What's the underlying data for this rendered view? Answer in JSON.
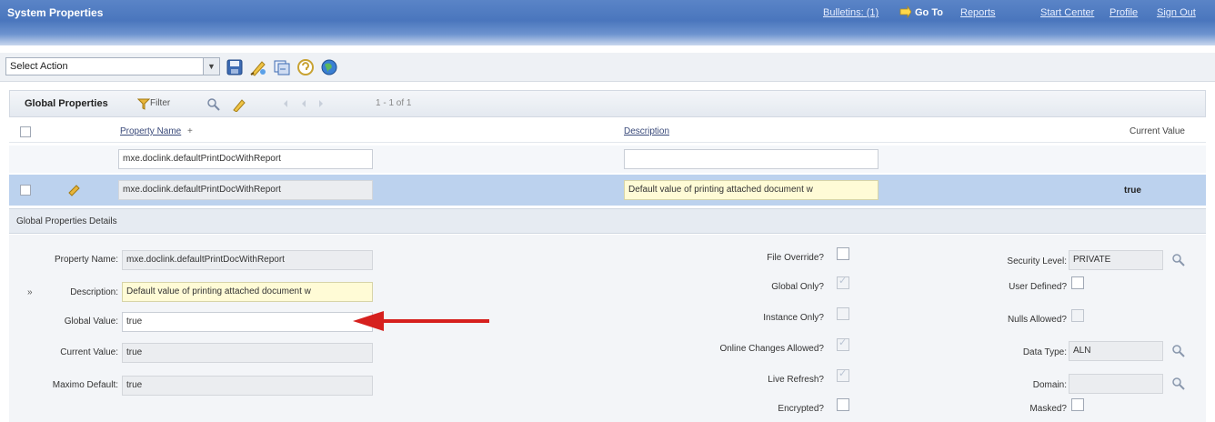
{
  "window": {
    "title": "System Properties"
  },
  "top_nav": {
    "bulletins": "Bulletins: (1)",
    "go_to": "Go To",
    "reports": "Reports",
    "start_center": "Start Center",
    "profile": "Profile",
    "sign_out": "Sign Out"
  },
  "toolbar": {
    "select_action": "Select Action",
    "icons": [
      "save-icon",
      "clear-changes-icon",
      "live-refresh-icon",
      "help-icon",
      "globe-icon"
    ]
  },
  "section": {
    "title": "Global Properties",
    "filter_label": "Filter",
    "pagination": "1 - 1 of 1"
  },
  "table": {
    "columns": {
      "property_name": "Property Name",
      "sort_indicator": "+",
      "description": "Description",
      "current_value": "Current Value"
    },
    "filter": {
      "property_name": "mxe.doclink.defaultPrintDocWithReport",
      "description": ""
    },
    "row": {
      "property_name": "mxe.doclink.defaultPrintDocWithReport",
      "description": "Default value of printing attached document w",
      "current_value": "true"
    }
  },
  "details": {
    "title": "Global Properties Details",
    "property_name_label": "Property Name:",
    "property_name_value": "mxe.doclink.defaultPrintDocWithReport",
    "description_label": "Description:",
    "description_value": "Default value of printing attached document w",
    "required_marker": "»",
    "global_value_label": "Global Value:",
    "global_value": "true",
    "current_value_label": "Current Value:",
    "current_value": "true",
    "maximo_default_label": "Maximo Default:",
    "maximo_default": "true",
    "file_override_label": "File Override?",
    "global_only_label": "Global Only?",
    "instance_only_label": "Instance Only?",
    "online_changes_label": "Online Changes Allowed?",
    "live_refresh_label": "Live Refresh?",
    "encrypted_label": "Encrypted?",
    "security_level_label": "Security Level:",
    "security_level_value": "PRIVATE",
    "user_defined_label": "User Defined?",
    "nulls_allowed_label": "Nulls Allowed?",
    "data_type_label": "Data Type:",
    "data_type_value": "ALN",
    "domain_label": "Domain:",
    "domain_value": "",
    "masked_label": "Masked?"
  },
  "colors": {
    "title_bar": "#4a76bd",
    "selected_row": "#bcd2ee",
    "required_field": "#fffbd6",
    "arrow": "#d6201e"
  }
}
